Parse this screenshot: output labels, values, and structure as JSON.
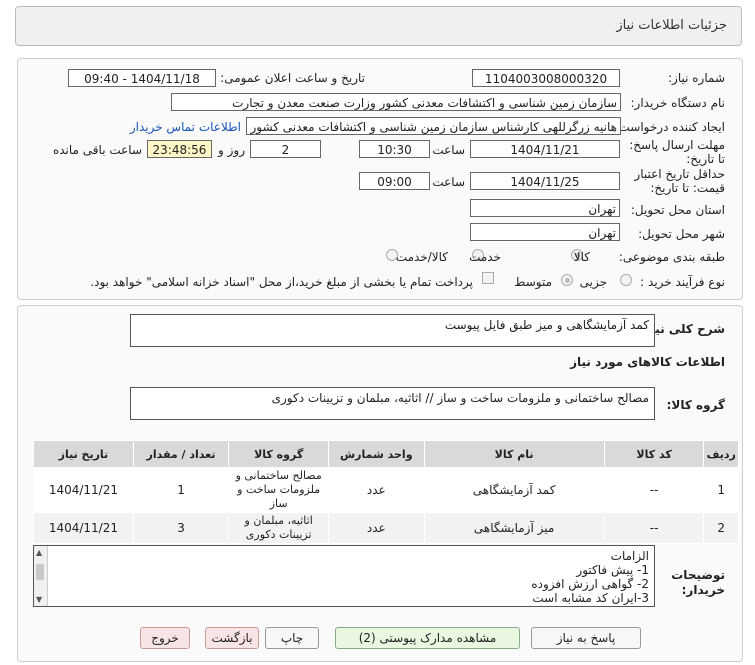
{
  "header": {
    "title": "جزئیات اطلاعات نیاز"
  },
  "fields": {
    "need_number_label": "شماره نیاز:",
    "need_number": "1104003008000320",
    "announce_label": "تاریخ و ساعت اعلان عمومی:",
    "announce_value": "1404/11/18 - 09:40",
    "buyer_org_label": "نام دستگاه خریدار:",
    "buyer_org": "سازمان زمین شناسی و اکتشافات معدنی کشور وزارت صنعت معدن و تجارت",
    "creator_label": "ایجاد کننده درخواست:",
    "creator": "هانیه زرگرللهی کارشناس سازمان زمین شناسی و اکتشافات معدنی کشور وزارت",
    "contact_link": "اطلاعات تماس خریدار",
    "deadline_label": "مهلت ارسال پاسخ: تا تاریخ:",
    "deadline_date": "1404/11/21",
    "hour_label": "ساعت",
    "deadline_time": "10:30",
    "days_value": "2",
    "days_label": "روز و",
    "remaining_time": "23:48:56",
    "remaining_label": "ساعت باقی مانده",
    "validity_label": "حداقل تاریخ اعتبار قیمت: تا تاریخ:",
    "validity_date": "1404/11/25",
    "validity_hour_label": "ساعت",
    "validity_time": "09:00",
    "province_label": "استان محل تحویل:",
    "province": "تهران",
    "city_label": "شهر محل تحویل:",
    "city": "تهران",
    "category_label": "طبقه بندی موضوعی:",
    "category_options": [
      "کالا",
      "خدمت",
      "کالا/خدمت"
    ],
    "process_label": "نوع فرآیند خرید :",
    "process_options": [
      "جزیی",
      "متوسط"
    ],
    "payment_note": "پرداخت تمام یا بخشی از مبلغ خرید،از محل \"اسناد خزانه اسلامی\" خواهد بود."
  },
  "details": {
    "general_desc_label": "شرح کلی نیاز:",
    "general_desc": "کمد آزمایشگاهی و میز طبق فایل پیوست",
    "goods_info_title": "اطلاعات کالاهای مورد نیاز",
    "goods_group_label": "گروه کالا:",
    "goods_group": "مصالح ساختمانی و ملزومات ساخت و ساز // اثاثیه، مبلمان و تزیینات دکوری"
  },
  "table": {
    "headers": [
      "ردیف",
      "کد کالا",
      "نام کالا",
      "واحد شمارش",
      "گروه کالا",
      "تعداد / مقدار",
      "تاریخ نیاز"
    ],
    "rows": [
      [
        "1",
        "--",
        "کمد آزمایشگاهی",
        "عدد",
        "مصالح ساختمانی و ملزومات ساخت و ساز",
        "1",
        "1404/11/21"
      ],
      [
        "2",
        "--",
        "میز آزمایشگاهی",
        "عدد",
        "اثاثیه، مبلمان و تزیینات دکوری",
        "3",
        "1404/11/21"
      ]
    ]
  },
  "buyer_notes": {
    "label": "توضیحات خریدار:",
    "lines": [
      "الزامات",
      "1-  پیش فاکتور",
      "2- گواهی ارزش افزوده",
      "3-ایران کد مشابه است"
    ]
  },
  "buttons": {
    "reply": "پاسخ به نیاز",
    "attachments": "مشاهده مدارک پیوستی (2)",
    "print": "چاپ",
    "back": "بازگشت",
    "exit": "خروج"
  },
  "colors": {
    "link": "#1a55b8",
    "timer_bg": "#fff6c8",
    "header_bg": "#f0f0f0"
  }
}
